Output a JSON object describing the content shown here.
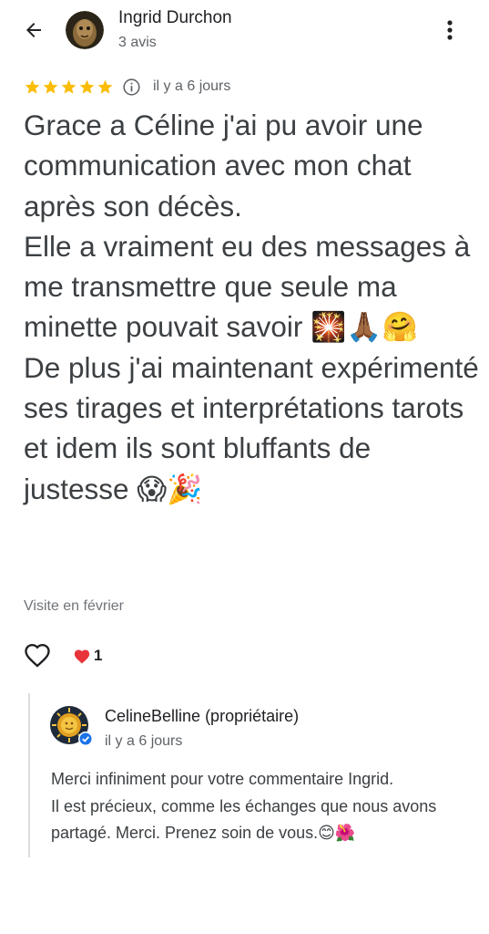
{
  "header": {
    "author_name": "Ingrid Durchon",
    "author_meta": "3 avis"
  },
  "review": {
    "rating": 5,
    "date": "il y a 6 jours",
    "lines": [
      "Grace a Céline j'ai pu avoir une communication avec mon chat après son décès.",
      "Elle a vraiment eu des messages à me transmettre que seule ma minette pouvait savoir 🎇🙏🏾🤗",
      "De plus j'ai maintenant expérimenté ses tirages et interprétations tarots et idem ils sont bluffants de justesse 😱🎉"
    ],
    "visit_info": "Visite en février",
    "reaction_emoji": "❤️",
    "reaction_count": "1"
  },
  "owner_reply": {
    "owner_name": "CelineBelline (propriétaire)",
    "date": "il y a 6 jours",
    "lines": [
      "Merci infiniment pour votre commentaire Ingrid.",
      "Il est précieux,  comme les échanges que nous avons partagé. Merci. Prenez soin de vous.😊🌺"
    ]
  },
  "icons": {
    "back": "arrow-left-icon",
    "more": "more-vert-icon",
    "info": "info-icon",
    "like": "heart-outline-icon",
    "verified": "verified-badge-icon"
  },
  "colors": {
    "star": "#fbbc04",
    "heart": "#e8333b",
    "verified": "#1a73e8",
    "reply_border": "#dadce0"
  }
}
